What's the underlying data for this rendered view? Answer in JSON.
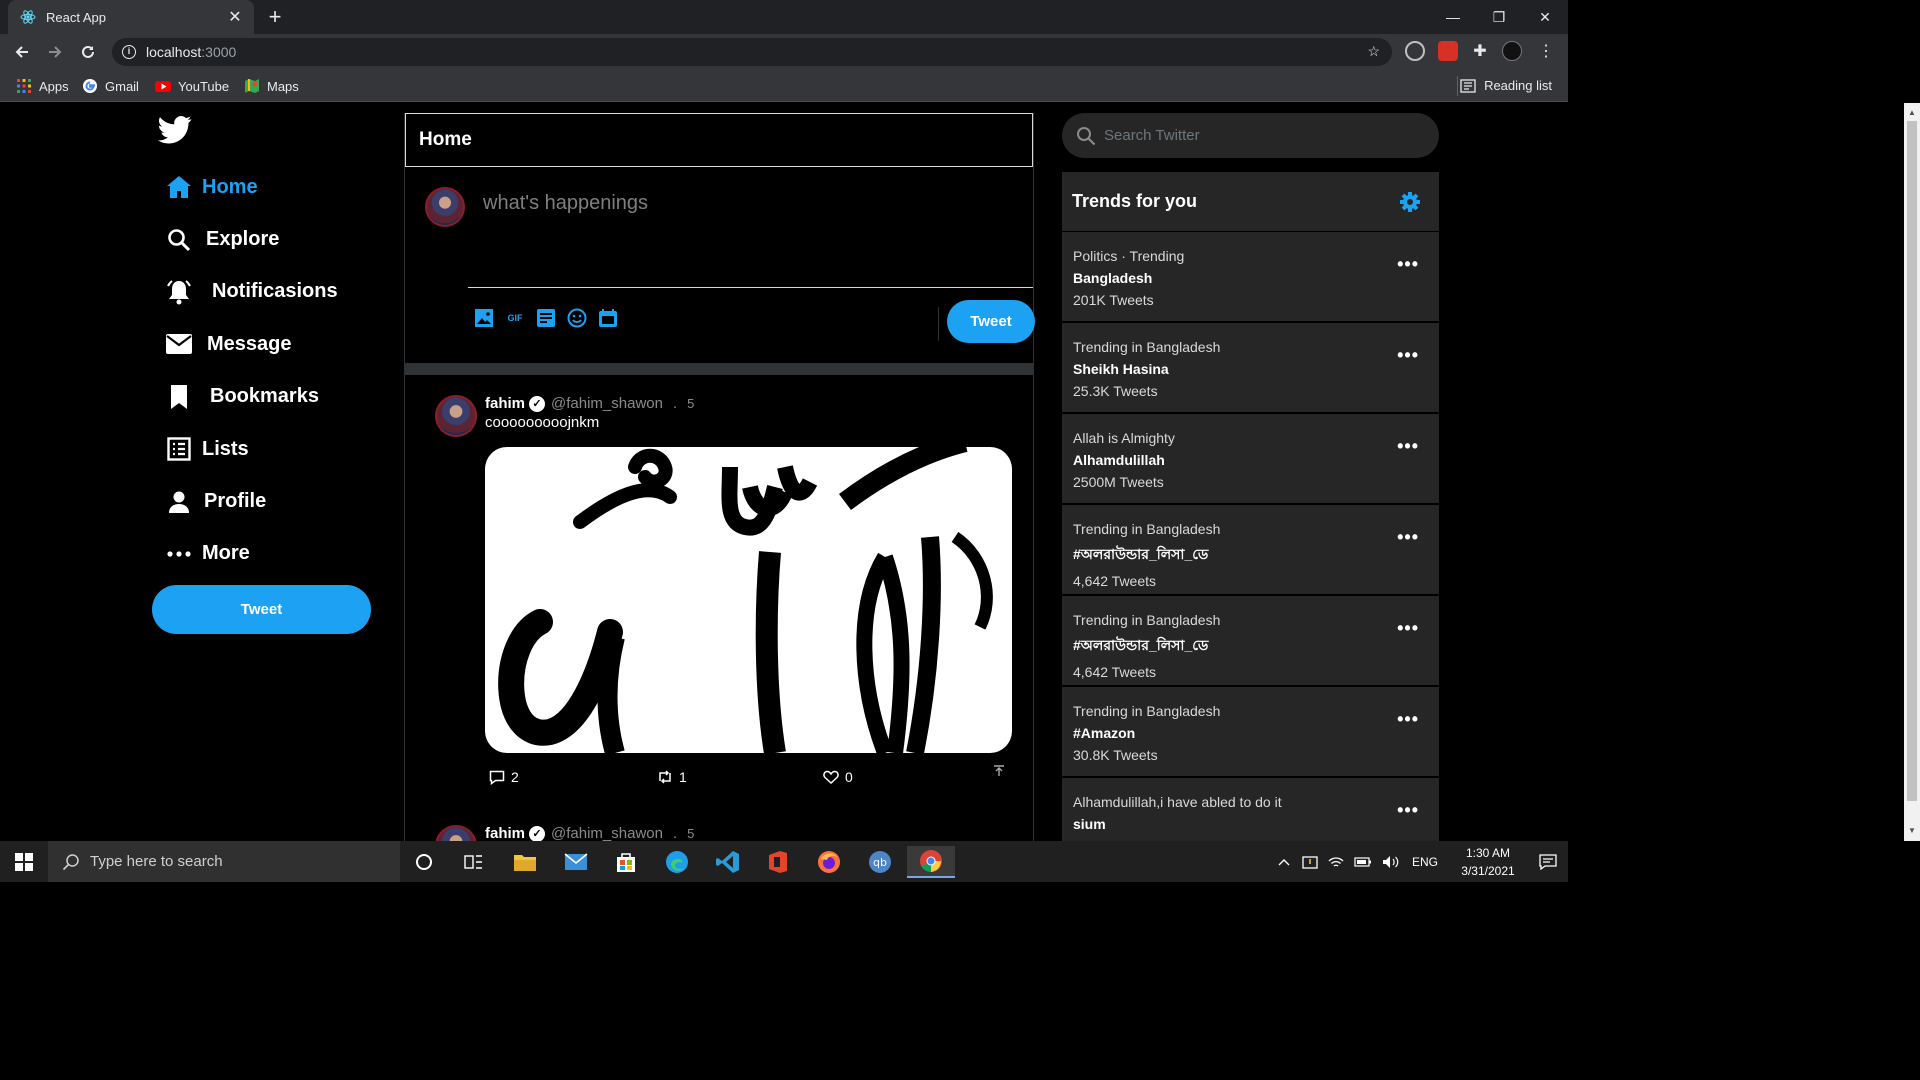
{
  "browser": {
    "tab_title": "React App",
    "url_host": "localhost",
    "url_port": ":3000",
    "bookmarks": [
      "Apps",
      "Gmail",
      "YouTube",
      "Maps"
    ],
    "reading_list": "Reading list"
  },
  "sidebar": {
    "items": [
      {
        "label": "Home",
        "icon": "home-icon"
      },
      {
        "label": "Explore",
        "icon": "search-icon"
      },
      {
        "label": "Notificasions",
        "icon": "bell-icon"
      },
      {
        "label": "Message",
        "icon": "mail-icon"
      },
      {
        "label": "Bookmarks",
        "icon": "bookmark-icon"
      },
      {
        "label": "Lists",
        "icon": "list-icon"
      },
      {
        "label": "Profile",
        "icon": "person-icon"
      },
      {
        "label": "More",
        "icon": "more-icon"
      }
    ],
    "tweet_label": "Tweet"
  },
  "feed": {
    "title": "Home",
    "composer_placeholder": "what's happenings",
    "tweet_label": "Tweet",
    "gif_label": "GIF",
    "posts": [
      {
        "name": "fahim",
        "handle": "@fahim_shawon",
        "dot": ".",
        "time": "5",
        "text": "cooooooooojnkm",
        "replies": "2",
        "retweets": "1",
        "likes": "0"
      },
      {
        "name": "fahim",
        "handle": "@fahim_shawon",
        "dot": ".",
        "time": "5"
      }
    ]
  },
  "right": {
    "search_placeholder": "Search Twitter",
    "trends_title": "Trends for you",
    "trends": [
      {
        "category": "Politics · Trending",
        "topic": "Bangladesh",
        "count": "201K Tweets"
      },
      {
        "category": "Trending in Bangladesh",
        "topic": "Sheikh Hasina",
        "count": "25.3K Tweets"
      },
      {
        "category": "Allah is Almighty",
        "topic": "Alhamdulillah",
        "count": "2500M Tweets"
      },
      {
        "category": "Trending in Bangladesh",
        "topic": "#অলরাউন্ডার_লিসা_ডে",
        "count": "4,642 Tweets"
      },
      {
        "category": "Trending in Bangladesh",
        "topic": "#অলরাউন্ডার_লিসা_ডে",
        "count": "4,642 Tweets"
      },
      {
        "category": "Trending in Bangladesh",
        "topic": "#Amazon",
        "count": "30.8K Tweets"
      },
      {
        "category": "Alhamdulillah,i have abled to do it",
        "topic": "sium",
        "count": ""
      }
    ]
  },
  "taskbar": {
    "search_placeholder": "Type here to search",
    "language": "ENG",
    "time": "1:30 AM",
    "date": "3/31/2021"
  },
  "colors": {
    "accent": "#1da1f2",
    "panel": "#262626",
    "background": "#000000"
  }
}
